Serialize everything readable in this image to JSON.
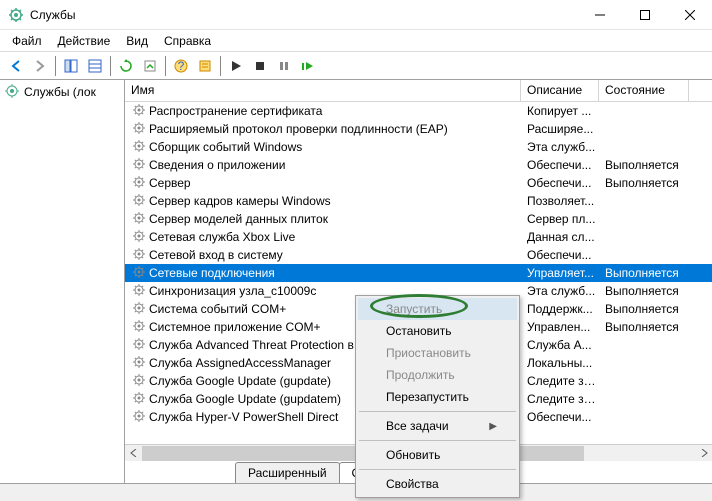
{
  "window": {
    "title": "Службы"
  },
  "menu": {
    "file": "Файл",
    "action": "Действие",
    "view": "Вид",
    "help": "Справка"
  },
  "tree": {
    "root": "Службы (лок"
  },
  "columns": {
    "name": "Имя",
    "desc": "Описание",
    "state": "Состояние"
  },
  "services": [
    {
      "name": "Распространение сертификата",
      "desc": "Копирует ...",
      "state": ""
    },
    {
      "name": "Расширяемый протокол проверки подлинности (EAP)",
      "desc": "Расширяе...",
      "state": ""
    },
    {
      "name": "Сборщик событий Windows",
      "desc": "Эта служб...",
      "state": ""
    },
    {
      "name": "Сведения о приложении",
      "desc": "Обеспечи...",
      "state": "Выполняется"
    },
    {
      "name": "Сервер",
      "desc": "Обеспечи...",
      "state": "Выполняется"
    },
    {
      "name": "Сервер кадров камеры Windows",
      "desc": "Позволяет...",
      "state": ""
    },
    {
      "name": "Сервер моделей данных плиток",
      "desc": "Сервер пл...",
      "state": ""
    },
    {
      "name": "Сетевая служба Xbox Live",
      "desc": "Данная сл...",
      "state": ""
    },
    {
      "name": "Сетевой вход в систему",
      "desc": "Обеспечи...",
      "state": ""
    },
    {
      "name": "Сетевые подключения",
      "desc": "Управляет...",
      "state": "Выполняется",
      "selected": true
    },
    {
      "name": "Синхронизация узла_c10009c",
      "desc": "Эта служб...",
      "state": "Выполняется"
    },
    {
      "name": "Система событий COM+",
      "desc": "Поддержк...",
      "state": "Выполняется"
    },
    {
      "name": "Системное приложение COM+",
      "desc": "Управлен...",
      "state": "Выполняется"
    },
    {
      "name": "Служба Advanced Threat Protection в Защитнике Windows",
      "desc": "Служба A...",
      "state": ""
    },
    {
      "name": "Служба AssignedAccessManager",
      "desc": "Локальны...",
      "state": ""
    },
    {
      "name": "Служба Google Update (gupdate)",
      "desc": "Следите за...",
      "state": ""
    },
    {
      "name": "Служба Google Update (gupdatem)",
      "desc": "Следите за...",
      "state": ""
    },
    {
      "name": "Служба Hyper-V PowerShell Direct",
      "desc": "Обеспечи...",
      "state": ""
    }
  ],
  "context_menu": {
    "start": "Запустить",
    "stop": "Остановить",
    "pause": "Приостановить",
    "resume": "Продолжить",
    "restart": "Перезапустить",
    "all_tasks": "Все задачи",
    "refresh": "Обновить",
    "properties": "Свойства"
  },
  "tabs": {
    "extended": "Расширенный",
    "standard": "Стандартный"
  }
}
